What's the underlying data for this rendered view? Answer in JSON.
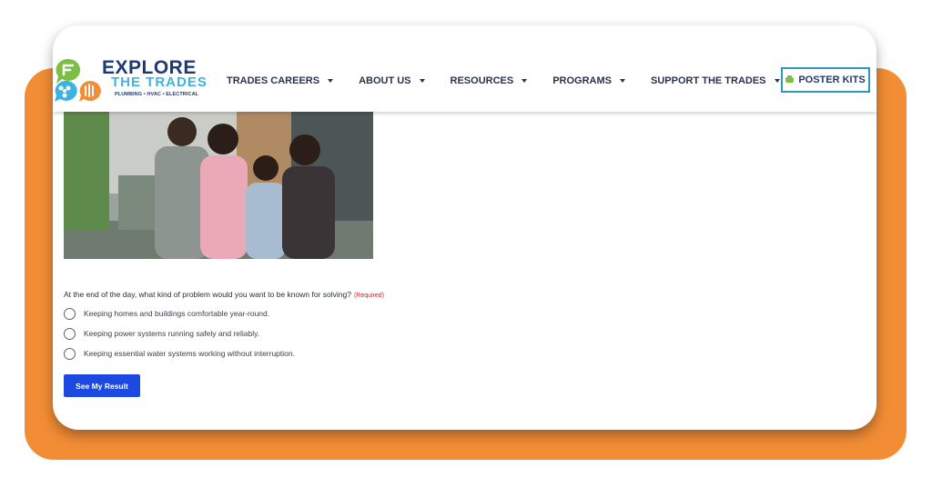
{
  "brand": {
    "title": "EXPLORE",
    "subtitle": "THE TRADES",
    "tagline": "PLUMBING • HVAC • ELECTRICAL"
  },
  "nav": {
    "items": [
      {
        "label": "TRADES CAREERS"
      },
      {
        "label": "ABOUT US"
      },
      {
        "label": "RESOURCES"
      },
      {
        "label": "PROGRAMS"
      },
      {
        "label": "SUPPORT THE TRADES"
      }
    ],
    "poster_kits_label": "POSTER KITS"
  },
  "quiz": {
    "question": "At the end of the day, what kind of problem would you want to be known for solving?",
    "required_label": "(Required)",
    "options": [
      {
        "label": "Keeping homes and buildings comfortable year-round."
      },
      {
        "label": "Keeping power systems running safely and reliably."
      },
      {
        "label": "Keeping essential water systems working without interruption."
      }
    ],
    "submit_label": "See My Result"
  },
  "colors": {
    "background_accent": "#f28d35",
    "brand_navy": "#1f3a73",
    "brand_blue": "#3db3e3",
    "brand_green": "#7dbf45",
    "button_blue": "#1b49e2",
    "required_red": "#c02b2b"
  }
}
